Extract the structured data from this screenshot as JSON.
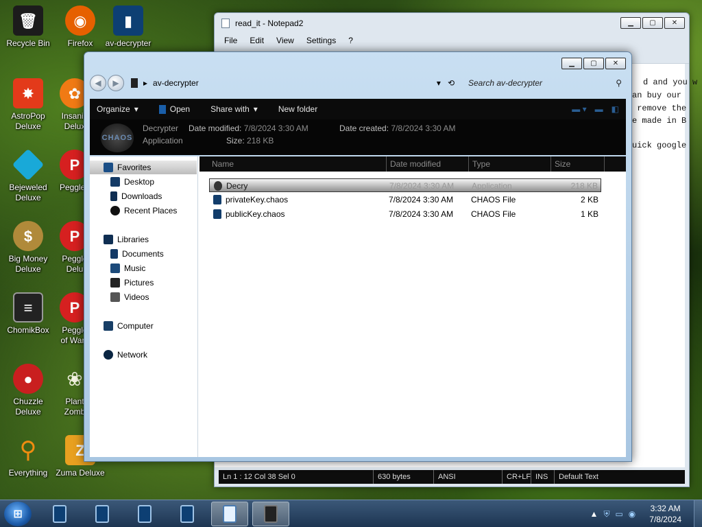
{
  "desktop_icons": [
    {
      "label1": "Recycle Bin",
      "label2": "",
      "icon": "recycle-bin-icon",
      "color": "#1c1c1c"
    },
    {
      "label1": "Firefox",
      "label2": "",
      "icon": "firefox-icon",
      "color": "#e66000"
    },
    {
      "label1": "av-decrypter",
      "label2": "",
      "icon": "av-decrypter-icon",
      "color": "#0d3f73"
    },
    {
      "label1": "AstroPop",
      "label2": "Deluxe",
      "icon": "astropop-icon",
      "color": "#e33a1a"
    },
    {
      "label1": "Insaniq",
      "label2": "Delux",
      "icon": "insaniquarium-icon",
      "color": "#f07a14"
    },
    {
      "label1": "Bejeweled",
      "label2": "Deluxe",
      "icon": "bejeweled-icon",
      "color": "#19a9d8"
    },
    {
      "label1": "Peggle I",
      "label2": "",
      "icon": "peggle-icon",
      "color": "#d62020"
    },
    {
      "label1": "Big Money",
      "label2": "Deluxe",
      "icon": "big-money-icon",
      "color": "#b08a3a"
    },
    {
      "label1": "Peggle",
      "label2": "Delu",
      "icon": "peggle-nights-icon",
      "color": "#d62020"
    },
    {
      "label1": "ChomikBox",
      "label2": "",
      "icon": "chomikbox-icon",
      "color": "#222222"
    },
    {
      "label1": "Peggle",
      "label2": "of Warc",
      "icon": "peggle-world-icon",
      "color": "#d62020"
    },
    {
      "label1": "Chuzzle",
      "label2": "Deluxe",
      "icon": "chuzzle-icon",
      "color": "#c91f1f"
    },
    {
      "label1": "Plant",
      "label2": "Zomb",
      "icon": "plants-zombies-icon",
      "color": "#f2f2e0"
    },
    {
      "label1": "Everything",
      "label2": "",
      "icon": "everything-icon",
      "color": "#f08c10"
    },
    {
      "label1": "Zuma Deluxe",
      "label2": "",
      "icon": "zuma-icon",
      "color": "#e8a020"
    }
  ],
  "notepad": {
    "title": "read_it - Notepad2",
    "menu": [
      "File",
      "Edit",
      "View",
      "Settings",
      "?"
    ],
    "lines": [
      "d and you w",
      "an buy our",
      " remove the",
      "e made in B",
      "",
      "uick google"
    ],
    "status": [
      "Ln 1 : 12   Col 38   Sel 0",
      "630 bytes",
      "ANSI",
      "CR+LF",
      "INS",
      "Default Text"
    ]
  },
  "explorer": {
    "address": "av-decrypter",
    "search_placeholder": "Search av-decrypter",
    "commands": {
      "organize": "Organize",
      "open": "Open",
      "share": "Share with",
      "new_folder": "New folder"
    },
    "details": {
      "logo_text": "CHAOS",
      "name": "Decrypter",
      "type": "Application",
      "modified_label": "Date modified:",
      "modified_value": "7/8/2024 3:30 AM",
      "created_label": "Date created:",
      "created_value": "7/8/2024 3:30 AM",
      "size_label": "Size:",
      "size_value": "218 KB"
    },
    "nav": {
      "favorites": "Favorites",
      "desktop": "Desktop",
      "downloads": "Downloads",
      "recent": "Recent Places",
      "libraries": "Libraries",
      "documents": "Documents",
      "music": "Music",
      "pictures": "Pictures",
      "videos": "Videos",
      "computer": "Computer",
      "network": "Network"
    },
    "columns": {
      "name": "Name",
      "date": "Date modified",
      "type": "Type",
      "size": "Size"
    },
    "files": [
      {
        "name": "Decry",
        "date": "7/8/2024 3:30 AM",
        "type": "Application",
        "size": "218 KB"
      },
      {
        "name": "privateKey.chaos",
        "date": "7/8/2024 3:30 AM",
        "type": "CHAOS File",
        "size": "2 KB"
      },
      {
        "name": "publicKey.chaos",
        "date": "7/8/2024 3:30 AM",
        "type": "CHAOS File",
        "size": "1 KB"
      }
    ]
  },
  "taskbar": {
    "time": "3:32 AM",
    "date": "7/8/2024"
  }
}
